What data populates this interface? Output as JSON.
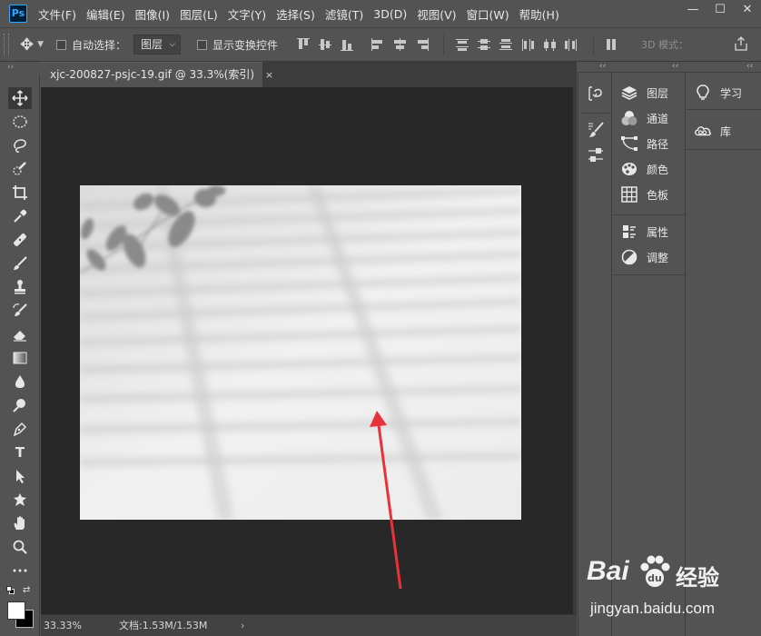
{
  "app": {
    "logo_text": "Ps"
  },
  "menu": [
    "文件(F)",
    "编辑(E)",
    "图像(I)",
    "图层(L)",
    "文字(Y)",
    "选择(S)",
    "滤镜(T)",
    "3D(D)",
    "视图(V)",
    "窗口(W)",
    "帮助(H)"
  ],
  "window_controls": {
    "minimize": "—",
    "restore": "☐",
    "close": "✕"
  },
  "options_bar": {
    "auto_select_label": "自动选择：",
    "auto_select_target": "图层",
    "auto_select_checked": false,
    "show_transform_label": "显示变换控件",
    "show_transform_checked": false,
    "mode_3d_label": "3D 模式："
  },
  "document": {
    "tab_title": "xjc-200827-psjc-19.gif @ 33.3%(索引)",
    "tab_close": "×",
    "zoom": "33.33%",
    "doc_info": "文档:1.53M/1.53M",
    "status_arrow": "›"
  },
  "panels": {
    "column1": [
      {
        "icon": "layers-icon",
        "label": "图层"
      },
      {
        "icon": "channels-icon",
        "label": "通道"
      },
      {
        "icon": "paths-icon",
        "label": "路径"
      },
      {
        "icon": "color-icon",
        "label": "颜色"
      },
      {
        "icon": "swatches-icon",
        "label": "色板"
      },
      {
        "icon": "properties-icon",
        "label": "属性"
      },
      {
        "icon": "adjustments-icon",
        "label": "调整"
      }
    ],
    "column2": [
      {
        "icon": "learn-icon",
        "label": "学习"
      },
      {
        "icon": "libraries-icon",
        "label": "库"
      }
    ]
  },
  "colors": {
    "ui_bg": "#535353",
    "canvas_bg": "#282828",
    "arrow": "#e8323a",
    "ps_blue": "#31a8ff"
  },
  "watermark": {
    "brand": "Bai",
    "brand_suffix": "经验",
    "url": "jingyan.baidu.com"
  }
}
